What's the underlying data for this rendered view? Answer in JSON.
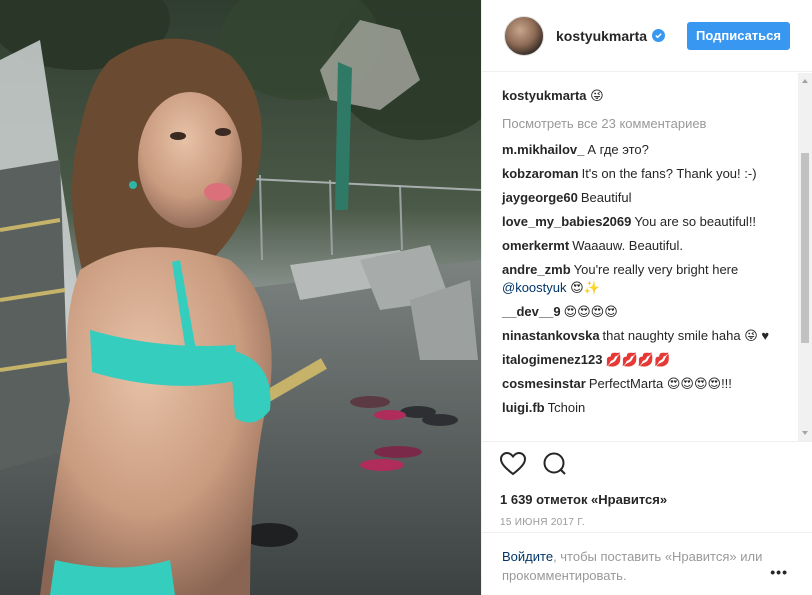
{
  "post": {
    "username": "kostyukmarta",
    "follow_label": "Подписаться",
    "caption_user": "kostyukmarta",
    "caption_text": "😜",
    "view_all_comments": "Посмотреть все 23 комментариев",
    "likes": "1 639 отметок «Нравится»",
    "date": "15 июня 2017 г.",
    "login_link": "Войдите",
    "login_text": ", чтобы поставить «Нравится» или прокомментировать.",
    "more_label": "•••"
  },
  "comments": [
    {
      "user": "m.mikhailov_",
      "text": "А где это?"
    },
    {
      "user": "kobzaroman",
      "text": "It's on the fans? Thank you! :-)"
    },
    {
      "user": "jaygeorge60",
      "text": "Beautiful"
    },
    {
      "user": "love_my_babies2069",
      "text": "You are so beautiful!!"
    },
    {
      "user": "omerkermt",
      "text": "Waaauw. Beautiful."
    },
    {
      "user": "andre_zmb",
      "text": "You're really very bright here",
      "mention": "@koostyuk",
      "text_after": " 😍✨"
    },
    {
      "user": "__dev__9",
      "text": "😍😍😍😍"
    },
    {
      "user": "ninastankovska",
      "text": "that naughty smile haha 😜 ♥"
    },
    {
      "user": "italogimenez123",
      "text": "💋💋💋💋"
    },
    {
      "user": "cosmesinstar",
      "text": "PerfectMarta 😍😍😍😍!!!"
    },
    {
      "user": "luigi.fb",
      "text": "Tchoin"
    }
  ],
  "icons": {
    "like": "heart-icon",
    "comment": "comment-icon",
    "verified": "verified-badge-icon",
    "more": "more-options-icon"
  },
  "colors": {
    "accent": "#3897f0",
    "link": "#003569",
    "muted": "#999999"
  }
}
